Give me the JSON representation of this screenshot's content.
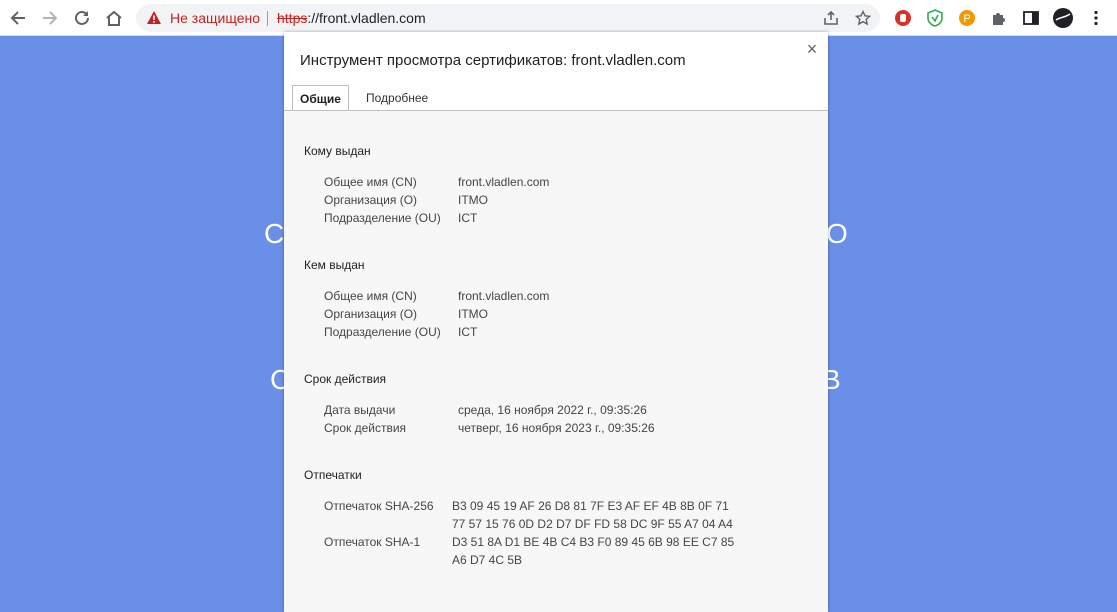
{
  "browser": {
    "security_label": "Не защищено",
    "url_scheme": "https",
    "url_rest": "://front.vladlen.com"
  },
  "background": {
    "text_left_1": "С",
    "text_right_1": "О",
    "text_left_2": "С",
    "text_right_2": "В"
  },
  "dialog": {
    "title": "Инструмент просмотра сертификатов: front.vladlen.com",
    "close_label": "×",
    "tabs": [
      {
        "label": "Общие",
        "active": true
      },
      {
        "label": "Подробнее",
        "active": false
      }
    ],
    "issued_to": {
      "title": "Кому выдан",
      "rows": [
        {
          "label": "Общее имя (CN)",
          "value": "front.vladlen.com"
        },
        {
          "label": "Организация (O)",
          "value": "ITMO"
        },
        {
          "label": "Подразделение (OU)",
          "value": "ICT"
        }
      ]
    },
    "issued_by": {
      "title": "Кем выдан",
      "rows": [
        {
          "label": "Общее имя (CN)",
          "value": "front.vladlen.com"
        },
        {
          "label": "Организация (O)",
          "value": "ITMO"
        },
        {
          "label": "Подразделение (OU)",
          "value": "ICT"
        }
      ]
    },
    "validity": {
      "title": "Срок действия",
      "rows": [
        {
          "label": "Дата выдачи",
          "value": "среда, 16 ноября 2022 г., 09:35:26"
        },
        {
          "label": "Срок действия",
          "value": "четверг, 16 ноября 2023 г., 09:35:26"
        }
      ]
    },
    "fingerprints": {
      "title": "Отпечатки",
      "sha256_label": "Отпечаток SHA-256",
      "sha256_line1": "B3 09 45 19 AF 26 D8 81 7F E3 AF EF 4B 8B 0F 71",
      "sha256_line2": "77 57 15 76 0D D2 D7 DF FD 58 DC 9F 55 A7 04 A4",
      "sha1_label": "Отпечаток SHA-1",
      "sha1_line1": "D3 51 8A D1 BE 4B C4 B3 F0 89 45 6B 98 EE C7 85",
      "sha1_line2": "A6 D7 4C 5B"
    }
  },
  "colors": {
    "page_background": "#6a8fe8",
    "not_secure": "#c5221f"
  }
}
